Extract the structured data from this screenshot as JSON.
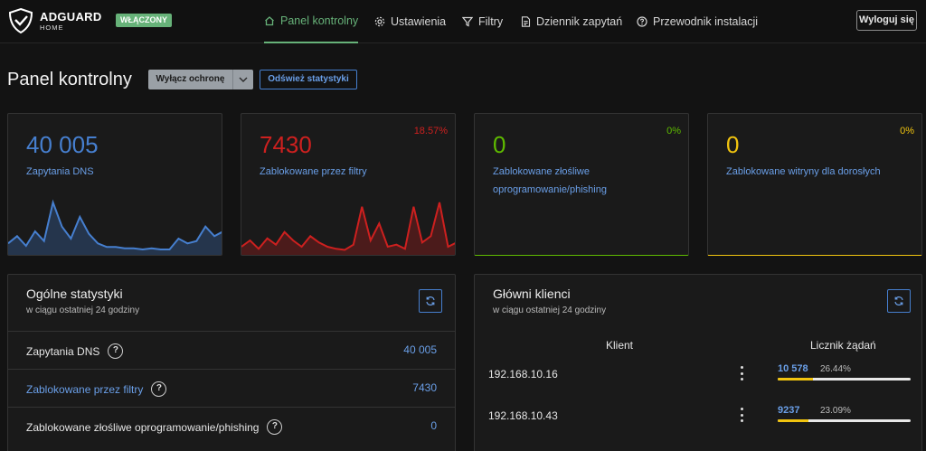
{
  "app": {
    "brand": "ADGUARD",
    "brand_sub": "HOME",
    "status": "WŁĄCZONY",
    "accent": "#67b279"
  },
  "nav": [
    {
      "label": "Panel kontrolny",
      "icon": "home-icon",
      "active": true
    },
    {
      "label": "Ustawienia",
      "icon": "gear-icon"
    },
    {
      "label": "Filtry",
      "icon": "filter-icon"
    },
    {
      "label": "Dziennik zapytań",
      "icon": "document-icon"
    },
    {
      "label": "Przewodnik instalacji",
      "icon": "help-circle-icon"
    }
  ],
  "logout_label": "Wyloguj się",
  "page": {
    "title": "Panel kontrolny",
    "toggle_label": "Wyłącz ochronę",
    "refresh_label": "Odśwież statystyki"
  },
  "cards": [
    {
      "value": "40 005",
      "label": "Zapytania DNS",
      "percent": "",
      "color": "#467fcf",
      "spark": [
        8,
        14,
        6,
        18,
        10,
        42,
        22,
        12,
        30,
        16,
        8,
        5,
        5,
        4,
        4,
        3,
        4,
        3,
        3,
        12,
        8,
        10,
        22,
        14,
        18
      ]
    },
    {
      "value": "7430",
      "label": "Zablokowane przez filtry",
      "percent": "18.57%",
      "color": "#cd201f",
      "spark": [
        6,
        12,
        4,
        14,
        8,
        20,
        12,
        6,
        16,
        10,
        6,
        4,
        3,
        8,
        44,
        12,
        28,
        6,
        8,
        4,
        44,
        10,
        16,
        48,
        6,
        10
      ]
    },
    {
      "value": "0",
      "label": "Zablokowane złośliwe oprogramowanie/phishing",
      "percent": "0%",
      "color": "#5eba00",
      "spark": []
    },
    {
      "value": "0",
      "label": "Zablokowane witryny dla dorosłych",
      "percent": "0%",
      "color": "#f1c40f",
      "spark": []
    }
  ],
  "general": {
    "title": "Ogólne statystyki",
    "subtitle": "w ciągu ostatniej 24 godziny",
    "rows": [
      {
        "name": "Zapytania DNS",
        "value": "40 005",
        "link": false
      },
      {
        "name": "Zablokowane przez filtry",
        "value": "7430",
        "link": true
      },
      {
        "name": "Zablokowane złośliwe oprogramowanie/phishing",
        "value": "0",
        "link": false
      }
    ]
  },
  "clients": {
    "title": "Główni klienci",
    "subtitle": "w ciągu ostatniej 24 godziny",
    "col_client": "Klient",
    "col_count": "Licznik żądań",
    "rows": [
      {
        "ip": "192.168.10.16",
        "count": "10 578",
        "percent": "26.44%",
        "fraction": 0.2644
      },
      {
        "ip": "192.168.10.43",
        "count": "9237",
        "percent": "23.09%",
        "fraction": 0.2309
      }
    ]
  }
}
